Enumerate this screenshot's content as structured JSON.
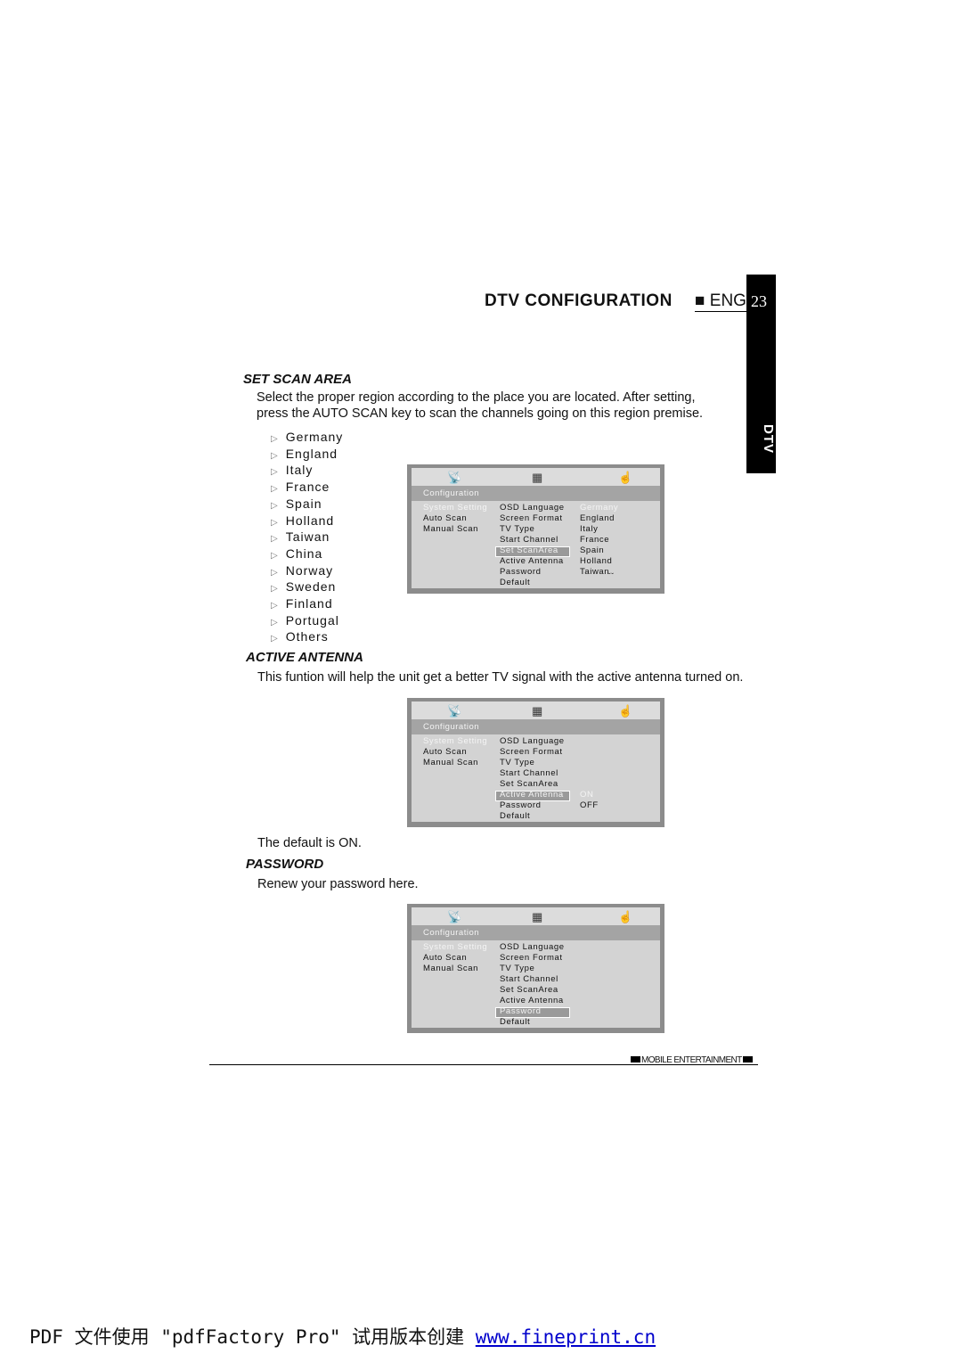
{
  "header": {
    "title": "DTV CONFIGURATION",
    "lang": "ENG",
    "page": "23",
    "side_tab": "DTV"
  },
  "set_scan_area": {
    "heading": "SET SCAN AREA",
    "line1": "Select the proper region according to the place you are located. After setting,",
    "line2": "press the AUTO SCAN key to scan the channels going on this region premise.",
    "countries": [
      "Germany",
      "England",
      "Italy",
      "France",
      "Spain",
      "Holland",
      "Taiwan",
      "China",
      "Norway",
      "Sweden",
      "Finland",
      "Portugal",
      "Others"
    ]
  },
  "active_antenna": {
    "heading": "ACTIVE ANTENNA",
    "text": "This funtion will help the unit get a better TV signal with the active antenna turned on.",
    "default": "The default is ON."
  },
  "password": {
    "heading": "PASSWORD",
    "text": "Renew your password here."
  },
  "menus": [
    {
      "title": "Configuration",
      "left": [
        "System Setting",
        "Auto Scan",
        "Manual Scan"
      ],
      "middle": [
        "OSD Language",
        "Screen Format",
        "TV Type",
        "Start Channel",
        "Set ScanArea",
        "Active Antenna",
        "Password",
        "Default"
      ],
      "selected": 4,
      "right": [
        "Germany",
        "England",
        "Italy",
        "France",
        "Spain",
        "Holland",
        "Taiwan"
      ],
      "right_start": 0,
      "more": "ˇˇ"
    },
    {
      "title": "Configuration",
      "left": [
        "System Setting",
        "Auto Scan",
        "Manual Scan"
      ],
      "middle": [
        "OSD Language",
        "Screen Format",
        "TV Type",
        "Start Channel",
        "Set ScanArea",
        "Active Antenna",
        "Password",
        "Default"
      ],
      "selected": 5,
      "right": [
        "ON",
        "OFF"
      ],
      "right_start": 5
    },
    {
      "title": "Configuration",
      "left": [
        "System Setting",
        "Auto Scan",
        "Manual Scan"
      ],
      "middle": [
        "OSD Language",
        "Screen Format",
        "TV Type",
        "Start Channel",
        "Set ScanArea",
        "Active Antenna",
        "Password",
        "Default"
      ],
      "selected": 6,
      "right": [],
      "right_start": 0
    }
  ],
  "menu_icons": [
    "antenna-device-icon",
    "monitor-icon",
    "hand-icon"
  ],
  "footer": {
    "brand": "MOBILE ENTERTAINMENT"
  },
  "watermark": {
    "text": "PDF 文件使用 \"pdfFactory Pro\" 试用版本创建 ",
    "link": "www.fineprint.cn"
  }
}
